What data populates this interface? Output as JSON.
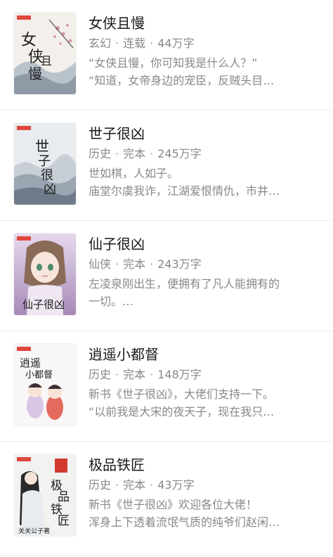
{
  "books": [
    {
      "title": "女侠且慢",
      "genre": "玄幻",
      "status": "连载",
      "words": "44万字",
      "desc_lines": [
        "“女侠且慢，你可知我是什么人？”",
        "“知道，女帝身边的宠臣，反贼头目…"
      ],
      "cover_text": "女侠且慢",
      "cover_theme": "ink-plum"
    },
    {
      "title": "世子很凶",
      "genre": "历史",
      "status": "完本",
      "words": "245万字",
      "desc_lines": [
        "世如棋，人如子。",
        "庙堂尔虞我诈，江湖爱恨情仇，市井…"
      ],
      "cover_text": "世子很凶",
      "cover_theme": "ink-mountain"
    },
    {
      "title": "仙子很凶",
      "genre": "仙侠",
      "status": "完本",
      "words": "243万字",
      "desc_lines": [
        "左凌泉刚出生，便拥有了凡人能拥有的",
        "一切。…"
      ],
      "cover_text": "仙子很凶",
      "cover_theme": "anime-purple"
    },
    {
      "title": "逍遥小都督",
      "genre": "历史",
      "status": "完本",
      "words": "148万字",
      "desc_lines": [
        "新书《世子很凶》，大佬们支持一下。",
        "“以前我是大宋的夜天子，现在我只…"
      ],
      "cover_text": "逍遥小都督",
      "cover_theme": "chibi-white"
    },
    {
      "title": "极品铁匠",
      "genre": "历史",
      "status": "完本",
      "words": "43万字",
      "desc_lines": [
        "新书《世子很凶》欢迎各位大佬！",
        "浑身上下透着流氓气质的纯爷们赵闲…"
      ],
      "cover_text": "极品铁匠",
      "cover_author": "关关公子著",
      "cover_theme": "ink-figure"
    }
  ],
  "separator": "·"
}
